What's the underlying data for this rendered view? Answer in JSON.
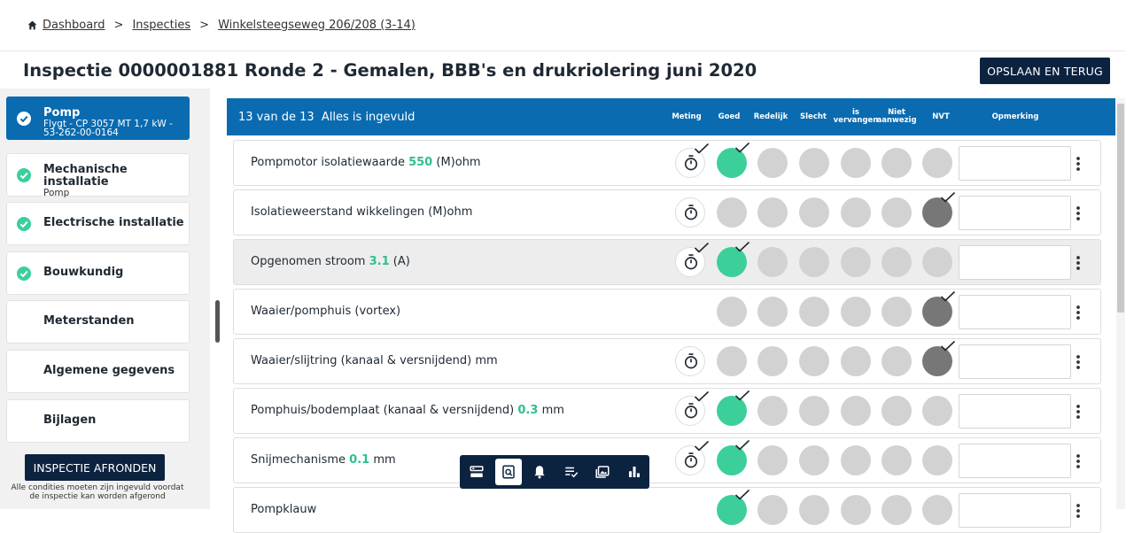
{
  "breadcrumb": {
    "items": [
      "Dashboard",
      "Inspecties",
      "Winkelsteegseweg 206/208 (3-14)"
    ],
    "separator": ">"
  },
  "page_title": "Inspectie 0000001881 Ronde 2 - Gemalen, BBB's en drukriolering juni 2020",
  "save_label": "OPSLAAN EN TERUG",
  "sidebar": {
    "items": [
      {
        "title": "Pomp",
        "subtitle": "Flygt - CP 3057 MT 1,7 kW - 53-262-00-0164",
        "done": true,
        "active": true
      },
      {
        "title": "Mechanische installatie",
        "subtitle": "Pomp",
        "done": true,
        "active": false
      },
      {
        "title": "Electrische installatie",
        "subtitle": "",
        "done": true,
        "active": false
      },
      {
        "title": "Bouwkundig",
        "subtitle": "",
        "done": true,
        "active": false
      },
      {
        "title": "Meterstanden",
        "subtitle": "",
        "done": false,
        "active": false
      },
      {
        "title": "Algemene gegevens",
        "subtitle": "",
        "done": false,
        "active": false
      },
      {
        "title": "Bijlagen",
        "subtitle": "",
        "done": false,
        "active": false
      }
    ],
    "finish_label": "INSPECTIE AFRONDEN",
    "finish_note": "Alle condities moeten zijn ingevuld voordat de inspectie kan worden afgerond"
  },
  "header": {
    "count_text": "13 van de 13",
    "status_text": "Alles is ingevuld",
    "columns": {
      "meting": "Meting",
      "goed": "Goed",
      "redelijk": "Redelijk",
      "slecht": "Slecht",
      "vervangen": "is vervangen",
      "niet_aanwezig": "Niet aanwezig",
      "nvt": "NVT",
      "opmerking": "Opmerking"
    }
  },
  "rows": [
    {
      "label": "Pompmotor isolatiewaarde",
      "value": "550",
      "unit": "(M)ohm",
      "measured": true,
      "has_meting": true,
      "selected": "goed",
      "highlight": false,
      "remark": ""
    },
    {
      "label": "Isolatieweerstand wikkelingen (M)ohm",
      "value": "",
      "unit": "",
      "measured": false,
      "has_meting": true,
      "selected": "nvt",
      "highlight": false,
      "remark": ""
    },
    {
      "label": "Opgenomen stroom",
      "value": "3.1",
      "unit": "(A)",
      "measured": true,
      "has_meting": true,
      "selected": "goed",
      "highlight": true,
      "remark": ""
    },
    {
      "label": "Waaier/pomphuis (vortex)",
      "value": "",
      "unit": "",
      "measured": false,
      "has_meting": false,
      "selected": "nvt",
      "highlight": false,
      "remark": ""
    },
    {
      "label": "Waaier/slijtring (kanaal & versnijdend) mm",
      "value": "",
      "unit": "",
      "measured": false,
      "has_meting": true,
      "selected": "nvt",
      "highlight": false,
      "remark": ""
    },
    {
      "label": "Pomphuis/bodemplaat (kanaal & versnijdend)",
      "value": "0.3",
      "unit": "mm",
      "measured": true,
      "has_meting": true,
      "selected": "goed",
      "highlight": false,
      "remark": ""
    },
    {
      "label": "Snijmechanisme",
      "value": "0.1",
      "unit": "mm",
      "measured": true,
      "has_meting": true,
      "selected": "goed",
      "highlight": false,
      "remark": ""
    },
    {
      "label": "Pompklauw",
      "value": "",
      "unit": "",
      "measured": false,
      "has_meting": false,
      "selected": "goed",
      "highlight": false,
      "remark": ""
    }
  ],
  "toolbar": {
    "items": [
      "list-view-icon",
      "inspect-search-icon",
      "bell-icon",
      "checklist-icon",
      "photos-icon",
      "chart-icon"
    ],
    "active_index": 1
  },
  "colors": {
    "navy": "#0c2340",
    "blue": "#0a6bb0",
    "green": "#3ccf9a",
    "grey": "#d2d2d2",
    "dark_grey": "#777777"
  }
}
